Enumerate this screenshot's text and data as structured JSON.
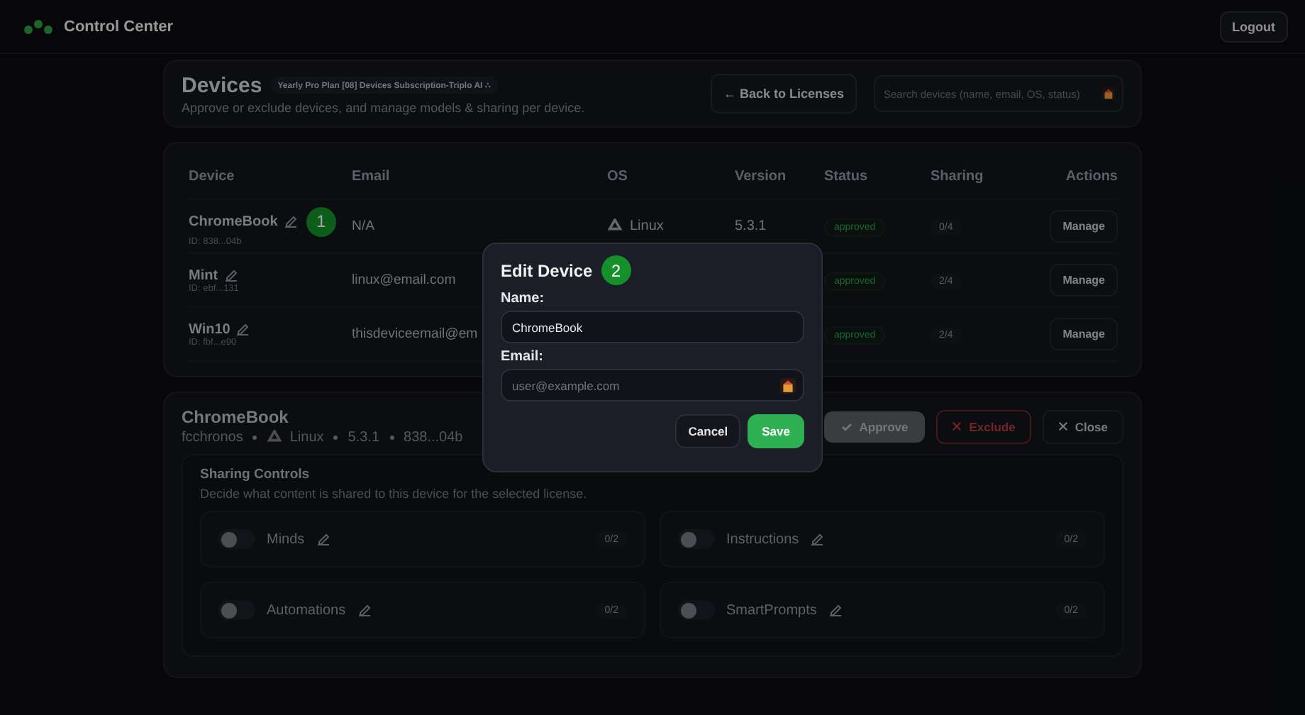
{
  "header": {
    "app_title": "Control Center",
    "logout": "Logout"
  },
  "devices_panel": {
    "title": "Devices",
    "plan_badge": "Yearly Pro Plan [08] Devices Subscription-Triplo AI ∴",
    "subtitle": "Approve or exclude devices, and manage models & sharing per device.",
    "back_button": "← Back to Licenses",
    "search": {
      "placeholder": "Search devices (name, email, OS, status)"
    }
  },
  "table": {
    "columns": [
      "Device",
      "Email",
      "OS",
      "Version",
      "Status",
      "Sharing",
      "Actions"
    ],
    "rows": [
      {
        "name": "ChromeBook",
        "id": "ID: 838...04b",
        "email": "N/A",
        "os": "Linux",
        "version": "5.3.1",
        "status": "approved",
        "sharing": "0/4",
        "action": "Manage",
        "marker": "1"
      },
      {
        "name": "Mint",
        "id": "ID: ebf...131",
        "email": "linux@email.com",
        "os": "",
        "version": "",
        "status": "approved",
        "sharing": "2/4",
        "action": "Manage"
      },
      {
        "name": "Win10",
        "id": "ID: fbf...e90",
        "email": "thisdeviceemail@em",
        "os": "",
        "version": "",
        "status": "approved",
        "sharing": "2/4",
        "action": "Manage"
      }
    ]
  },
  "detail": {
    "name": "ChromeBook",
    "meta": [
      "fcchronos",
      "Linux",
      "5.3.1",
      "838...04b"
    ],
    "approve": {
      "label": "Approve",
      "disabled": true
    },
    "exclude": "Exclude",
    "close": "Close",
    "sharing": {
      "title": "Sharing Controls",
      "subtitle": "Decide what content is shared to this device for the selected license.",
      "items": [
        {
          "label": "Minds",
          "count": "0/2",
          "on": false
        },
        {
          "label": "Instructions",
          "count": "0/2",
          "on": false
        },
        {
          "label": "Automations",
          "count": "0/2",
          "on": false
        },
        {
          "label": "SmartPrompts",
          "count": "0/2",
          "on": false
        }
      ]
    }
  },
  "modal": {
    "title": "Edit Device",
    "marker": "2",
    "name_label": "Name:",
    "name_value": "ChromeBook",
    "email_label": "Email:",
    "email_placeholder": "user@example.com",
    "cancel": "Cancel",
    "save": "Save"
  }
}
